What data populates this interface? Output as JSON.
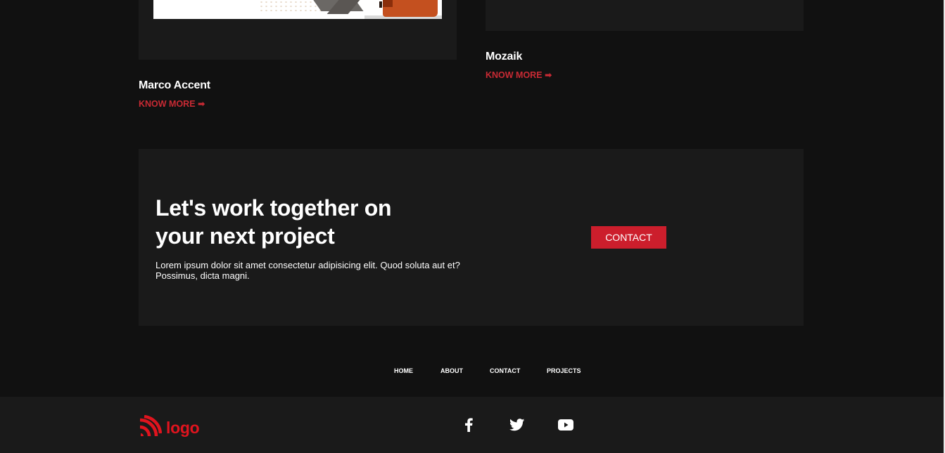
{
  "projects": [
    {
      "title": "Marco Accent",
      "link_label": "KNOW MORE ➡"
    },
    {
      "title": "Mozaik",
      "link_label": "KNOW MORE ➡"
    }
  ],
  "cta": {
    "heading_line1": "Let's work together on",
    "heading_line2": "your next project",
    "text_line1": "Lorem ipsum dolor sit amet consectetur adipisicing elit. Quod soluta aut et?",
    "text_line2": "Possimus, dicta magni.",
    "button_label": "CONTACT"
  },
  "footer_nav": [
    "HOME",
    "ABOUT",
    "CONTACT",
    "PROJECTS"
  ],
  "footer": {
    "logo_text": "logo",
    "logo_icon": "wifi-signal-icon",
    "social_icons": [
      "facebook-icon",
      "twitter-icon",
      "youtube-icon"
    ]
  },
  "colors": {
    "accent": "#cc1e2c",
    "logo_red": "#e0141e",
    "page_background": "#111111",
    "panel_background": "#1a1a1a"
  }
}
